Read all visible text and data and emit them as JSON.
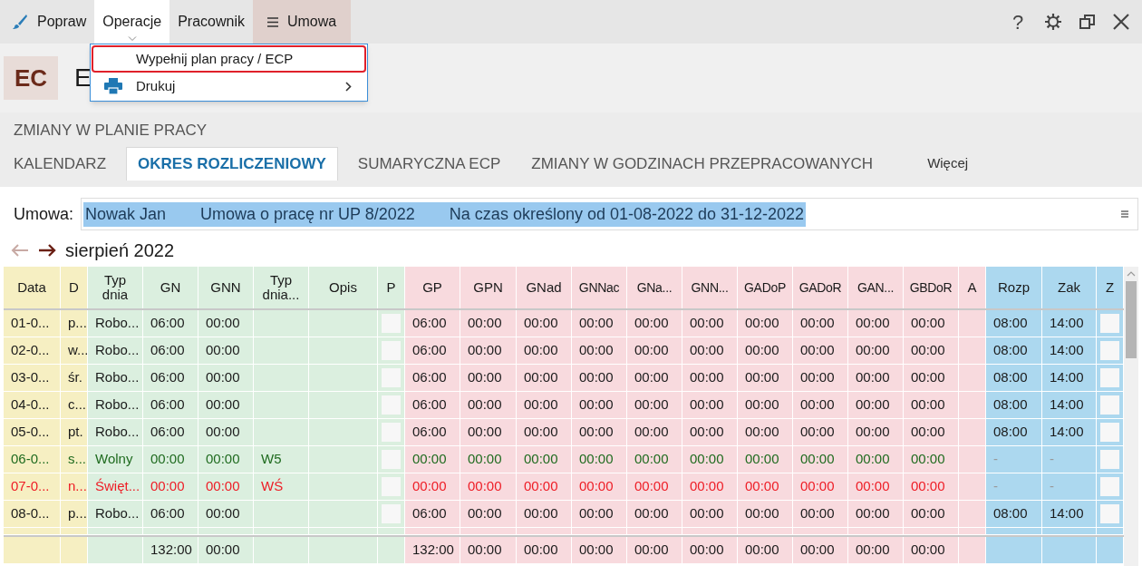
{
  "toolbar": {
    "items": [
      {
        "label": "Popraw",
        "kind": "brush",
        "selected": false
      },
      {
        "label": "Operacje",
        "kind": "plain",
        "selected": true
      },
      {
        "label": "Pracownik",
        "kind": "plain",
        "selected": false
      },
      {
        "label": "Umowa",
        "kind": "menu",
        "selected": false
      }
    ]
  },
  "window_controls": [
    "?"
  ],
  "menu": {
    "items": [
      {
        "label": "Wypełnij plan pracy / ECP",
        "kind": "plain",
        "highlighted": true
      },
      {
        "label": "Drukuj",
        "kind": "printer",
        "highlighted": false
      }
    ]
  },
  "header": {
    "badge": "EC",
    "title": "E"
  },
  "section_title": "ZMIANY W PLANIE PRACY",
  "tabs": [
    {
      "label": "KALENDARZ",
      "selected": false
    },
    {
      "label": "OKRES ROZLICZENIOWY",
      "selected": true
    },
    {
      "label": "SUMARYCZNA ECP",
      "selected": false
    },
    {
      "label": "ZMIANY W GODZINACH PRZEPRACOWANYCH",
      "selected": false
    },
    {
      "label": "Więcej",
      "selected": false
    }
  ],
  "contract": {
    "label": "Umowa:",
    "parts": [
      "Nowak Jan",
      "Umowa o pracę nr UP 8/2022",
      "Na czas określony od 01-08-2022 do 31-12-2022"
    ]
  },
  "period": {
    "label": "sierpień 2022"
  },
  "table": {
    "columns": [
      {
        "label": "Data",
        "color": "#f6efc2",
        "kind": "text"
      },
      {
        "label": "D",
        "color": "#f6efc2",
        "kind": "text"
      },
      {
        "label": "Typ dnia",
        "color": "#dbefdf",
        "kind": "text"
      },
      {
        "label": "GN",
        "color": "#dbefdf",
        "kind": "text"
      },
      {
        "label": "GNN",
        "color": "#dbefdf",
        "kind": "text"
      },
      {
        "label": "Typ dnia...",
        "color": "#dbefdf",
        "kind": "text"
      },
      {
        "label": "Opis",
        "color": "#dbefdf",
        "kind": "text"
      },
      {
        "label": "P",
        "color": "#dbefdf",
        "kind": "check"
      },
      {
        "label": "GP",
        "color": "#f8dade",
        "kind": "text"
      },
      {
        "label": "GPN",
        "color": "#f8dade",
        "kind": "text"
      },
      {
        "label": "GNad",
        "color": "#f8dade",
        "kind": "text"
      },
      {
        "label": "GNNac",
        "color": "#f8dade",
        "kind": "text"
      },
      {
        "label": "GNa...",
        "color": "#f8dade",
        "kind": "text"
      },
      {
        "label": "GNN...",
        "color": "#f8dade",
        "kind": "text"
      },
      {
        "label": "GADoP",
        "color": "#f8dade",
        "kind": "text"
      },
      {
        "label": "GADoR",
        "color": "#f8dade",
        "kind": "text"
      },
      {
        "label": "GAN...",
        "color": "#f8dade",
        "kind": "text"
      },
      {
        "label": "GBDoR",
        "color": "#f8dade",
        "kind": "text"
      },
      {
        "label": "A",
        "color": "#f8dade",
        "kind": "text"
      },
      {
        "label": "Rozp",
        "color": "#acd8ef",
        "kind": "text"
      },
      {
        "label": "Zak",
        "color": "#acd8ef",
        "kind": "text"
      },
      {
        "label": "Z",
        "color": "#acd8ef",
        "kind": "check"
      }
    ],
    "rows": [
      {
        "kind": "work",
        "data": "01-0...",
        "d": "p...",
        "typ": "Robo...",
        "gn": "06:00",
        "gnn": "00:00",
        "p": false,
        "gp": "06:00",
        "gpn": "00:00",
        "gnad": "00:00",
        "gnnac": "00:00",
        "gna": "00:00",
        "gnn2": "00:00",
        "gadop": "00:00",
        "gador": "00:00",
        "gan": "00:00",
        "gbdor": "00:00",
        "rozp": "08:00",
        "zak": "14:00",
        "z": false
      },
      {
        "kind": "work",
        "data": "02-0...",
        "d": "w...",
        "typ": "Robo...",
        "gn": "06:00",
        "gnn": "00:00",
        "p": false,
        "gp": "06:00",
        "gpn": "00:00",
        "gnad": "00:00",
        "gnnac": "00:00",
        "gna": "00:00",
        "gnn2": "00:00",
        "gadop": "00:00",
        "gador": "00:00",
        "gan": "00:00",
        "gbdor": "00:00",
        "rozp": "08:00",
        "zak": "14:00",
        "z": false
      },
      {
        "kind": "work",
        "data": "03-0...",
        "d": "śr.",
        "typ": "Robo...",
        "gn": "06:00",
        "gnn": "00:00",
        "p": false,
        "gp": "06:00",
        "gpn": "00:00",
        "gnad": "00:00",
        "gnnac": "00:00",
        "gna": "00:00",
        "gnn2": "00:00",
        "gadop": "00:00",
        "gador": "00:00",
        "gan": "00:00",
        "gbdor": "00:00",
        "rozp": "08:00",
        "zak": "14:00",
        "z": false
      },
      {
        "kind": "work",
        "data": "04-0...",
        "d": "c...",
        "typ": "Robo...",
        "gn": "06:00",
        "gnn": "00:00",
        "p": false,
        "gp": "06:00",
        "gpn": "00:00",
        "gnad": "00:00",
        "gnnac": "00:00",
        "gna": "00:00",
        "gnn2": "00:00",
        "gadop": "00:00",
        "gador": "00:00",
        "gan": "00:00",
        "gbdor": "00:00",
        "rozp": "08:00",
        "zak": "14:00",
        "z": false
      },
      {
        "kind": "work",
        "data": "05-0...",
        "d": "pt.",
        "typ": "Robo...",
        "gn": "06:00",
        "gnn": "00:00",
        "p": false,
        "gp": "06:00",
        "gpn": "00:00",
        "gnad": "00:00",
        "gnnac": "00:00",
        "gna": "00:00",
        "gnn2": "00:00",
        "gadop": "00:00",
        "gador": "00:00",
        "gan": "00:00",
        "gbdor": "00:00",
        "rozp": "08:00",
        "zak": "14:00",
        "z": false
      },
      {
        "kind": "free",
        "data": "06-0...",
        "d": "s...",
        "typ": "Wolny",
        "gn": "00:00",
        "gnn": "00:00",
        "typ2": "W5",
        "p": false,
        "gp": "00:00",
        "gpn": "00:00",
        "gnad": "00:00",
        "gnnac": "00:00",
        "gna": "00:00",
        "gnn2": "00:00",
        "gadop": "00:00",
        "gador": "00:00",
        "gan": "00:00",
        "gbdor": "00:00",
        "rozp": "-",
        "zak": "-",
        "z": false
      },
      {
        "kind": "holiday",
        "data": "07-0...",
        "d": "n...",
        "typ": "Święt...",
        "gn": "00:00",
        "gnn": "00:00",
        "typ2": "WŚ",
        "p": false,
        "gp": "00:00",
        "gpn": "00:00",
        "gnad": "00:00",
        "gnnac": "00:00",
        "gna": "00:00",
        "gnn2": "00:00",
        "gadop": "00:00",
        "gador": "00:00",
        "gan": "00:00",
        "gbdor": "00:00",
        "rozp": "-",
        "zak": "-",
        "z": false
      },
      {
        "kind": "work",
        "data": "08-0...",
        "d": "p...",
        "typ": "Robo...",
        "gn": "06:00",
        "gnn": "00:00",
        "p": false,
        "gp": "06:00",
        "gpn": "00:00",
        "gnad": "00:00",
        "gnnac": "00:00",
        "gna": "00:00",
        "gnn2": "00:00",
        "gadop": "00:00",
        "gador": "00:00",
        "gan": "00:00",
        "gbdor": "00:00",
        "rozp": "08:00",
        "zak": "14:00",
        "z": false
      }
    ],
    "totals": {
      "gn": "132:00",
      "gnn": "00:00",
      "gp": "132:00",
      "gpn": "00:00",
      "gnad": "00:00",
      "gnnac": "00:00",
      "gna": "00:00",
      "gnn2": "00:00",
      "gadop": "00:00",
      "gador": "00:00",
      "gan": "00:00",
      "gbdor": "00:00"
    }
  }
}
